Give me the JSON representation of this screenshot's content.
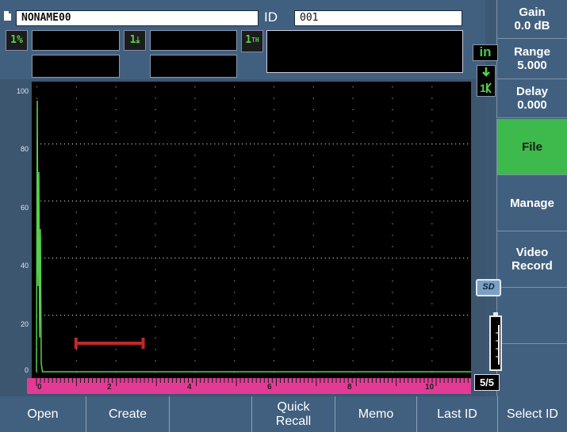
{
  "header": {
    "filename": "NONAME00",
    "id_label": "ID",
    "id_value": "001"
  },
  "gates": {
    "gate1_percent_label": "1%",
    "gate1_depth_label": "1",
    "gate1_th_label": "1"
  },
  "right_menu": {
    "gain": {
      "label": "Gain",
      "value": "0.0 dB"
    },
    "range": {
      "label": "Range",
      "value": "5.000"
    },
    "delay": {
      "label": "Delay",
      "value": "0.000"
    },
    "file_label": "File",
    "manage_label": "Manage",
    "video_record_label_1": "Video",
    "video_record_label_2": "Record"
  },
  "status": {
    "unit": "in",
    "sd_label": "SD",
    "page": "5/5"
  },
  "bottom_menu": {
    "open": "Open",
    "create": "Create",
    "empty": "",
    "quick_recall_1": "Quick",
    "quick_recall_2": "Recall",
    "memo": "Memo",
    "last_id": "Last ID",
    "select_id": "Select ID"
  },
  "colors": {
    "accent_green": "#3eb94b",
    "ruler_pink": "#e23b96",
    "gate_red": "#c0282a",
    "trace_green": "#55d04a"
  },
  "chart_data": {
    "type": "line",
    "y_tick_labels": [
      "100",
      "80",
      "60",
      "40",
      "20",
      "0"
    ],
    "x_tick_labels": [
      "0",
      "2",
      "4",
      "6",
      "8",
      "10"
    ],
    "ylim": [
      0,
      100
    ],
    "xlim": [
      0,
      11
    ],
    "series": [
      {
        "x": [
          0,
          0.02,
          0.04,
          0.06,
          0.08,
          0.1,
          0.12,
          0.15,
          11
        ],
        "y": [
          0,
          95,
          30,
          70,
          12,
          50,
          3,
          0,
          0
        ]
      }
    ],
    "gate": {
      "start": 1.0,
      "end": 2.7,
      "level": 10
    }
  }
}
